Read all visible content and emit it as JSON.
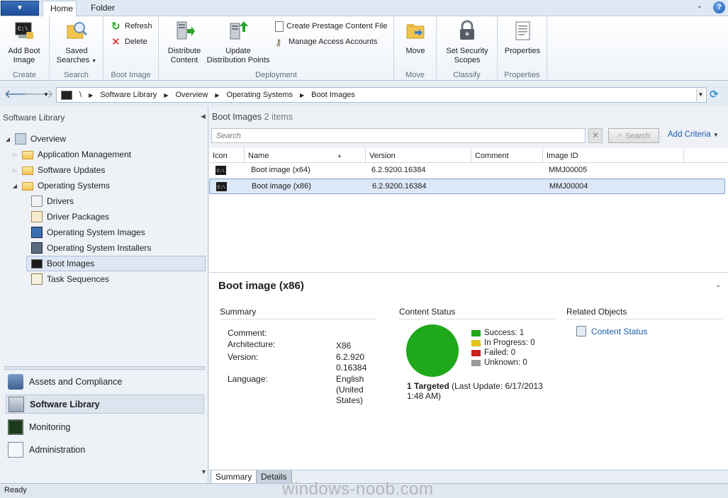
{
  "ribbon": {
    "tabs": [
      "Home",
      "Folder"
    ],
    "groups": {
      "create": {
        "label": "Create",
        "add_boot_image": "Add Boot\nImage"
      },
      "search": {
        "label": "Search",
        "saved_searches": "Saved\nSearches"
      },
      "boot_image": {
        "label": "Boot Image",
        "refresh": "Refresh",
        "delete": "Delete"
      },
      "deployment": {
        "label": "Deployment",
        "distribute_content": "Distribute\nContent",
        "update_dps": "Update\nDistribution Points",
        "create_prestage": "Create Prestage Content File",
        "manage_access": "Manage Access Accounts"
      },
      "move": {
        "label": "Move",
        "move": "Move"
      },
      "classify": {
        "label": "Classify",
        "set_security_scopes": "Set Security\nScopes"
      },
      "properties": {
        "label": "Properties",
        "properties": "Properties"
      }
    }
  },
  "address": {
    "root": "\\",
    "crumbs": [
      "Software Library",
      "Overview",
      "Operating Systems",
      "Boot Images"
    ]
  },
  "nav": {
    "title": "Software Library",
    "tree": {
      "overview": "Overview",
      "app_mgmt": "Application Management",
      "sw_updates": "Software Updates",
      "os": "Operating Systems",
      "drivers": "Drivers",
      "driver_packages": "Driver Packages",
      "os_images": "Operating System Images",
      "os_installers": "Operating System Installers",
      "boot_images": "Boot Images",
      "task_sequences": "Task Sequences"
    },
    "workspaces": [
      "Assets and Compliance",
      "Software Library",
      "Monitoring",
      "Administration"
    ]
  },
  "list": {
    "title": "Boot Images",
    "count": "2 items",
    "search_placeholder": "Search",
    "search_button": "Search",
    "add_criteria": "Add Criteria",
    "columns": [
      "Icon",
      "Name",
      "Version",
      "Comment",
      "Image ID"
    ],
    "rows": [
      {
        "name": "Boot image (x64)",
        "version": "6.2.9200.16384",
        "comment": "",
        "image_id": "MMJ00005"
      },
      {
        "name": "Boot image (x86)",
        "version": "6.2.9200.16384",
        "comment": "",
        "image_id": "MMJ00004"
      }
    ]
  },
  "detail": {
    "title": "Boot image (x86)",
    "summary": {
      "heading": "Summary",
      "comment_label": "Comment:",
      "arch_label": "Architecture:",
      "arch_value": "X86",
      "version_label": "Version:",
      "version_value": "6.2.920\n0.16384",
      "language_label": "Language:",
      "language_value": "English\n(United\nStates)"
    },
    "content_status": {
      "heading": "Content Status",
      "legend": [
        {
          "label": "Success: 1",
          "color": "#1fa81a"
        },
        {
          "label": "In Progress: 0",
          "color": "#e3c31b"
        },
        {
          "label": "Failed: 0",
          "color": "#c81e1e"
        },
        {
          "label": "Unknown: 0",
          "color": "#9a9a9a"
        }
      ],
      "targeted": "1 Targeted",
      "last_update": "(Last Update: 6/17/2013 1:48 AM)",
      "pie_color": "#1fa81a"
    },
    "related": {
      "heading": "Related Objects",
      "link": "Content Status"
    }
  },
  "bottom_tabs": [
    "Summary",
    "Details"
  ],
  "status": {
    "text": "Ready",
    "watermark": "windows-noob.com"
  }
}
